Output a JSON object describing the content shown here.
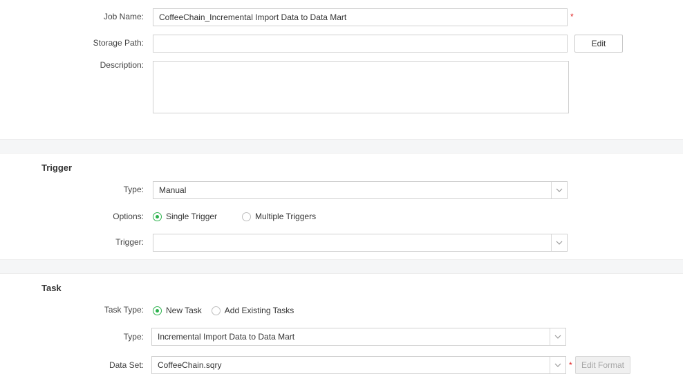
{
  "job": {
    "name_label": "Job Name:",
    "name_value": "CoffeeChain_Incremental Import Data to Data Mart",
    "required_mark": "*",
    "storage_label": "Storage Path:",
    "storage_value": "",
    "edit_button": "Edit",
    "description_label": "Description:",
    "description_value": ""
  },
  "trigger": {
    "section_title": "Trigger",
    "type_label": "Type:",
    "type_value": "Manual",
    "options_label": "Options:",
    "options": [
      "Single Trigger",
      "Multiple Triggers"
    ],
    "selected_option": "Single Trigger",
    "trigger_label": "Trigger:",
    "trigger_value": ""
  },
  "task": {
    "section_title": "Task",
    "task_type_label": "Task Type:",
    "task_types": [
      "New Task",
      "Add Existing Tasks"
    ],
    "selected_task_type": "New Task",
    "type_label": "Type:",
    "type_value": "Incremental Import Data to Data Mart",
    "dataset_label": "Data Set:",
    "dataset_value": "CoffeeChain.sqry",
    "required_mark": "*",
    "edit_format_button": "Edit Format"
  },
  "icons": {
    "dropdown": "chevron-down-icon",
    "radio": "radio-icon"
  },
  "colors": {
    "accent": "#2bb24c",
    "required": "#e02020",
    "band": "#f5f6f7"
  }
}
